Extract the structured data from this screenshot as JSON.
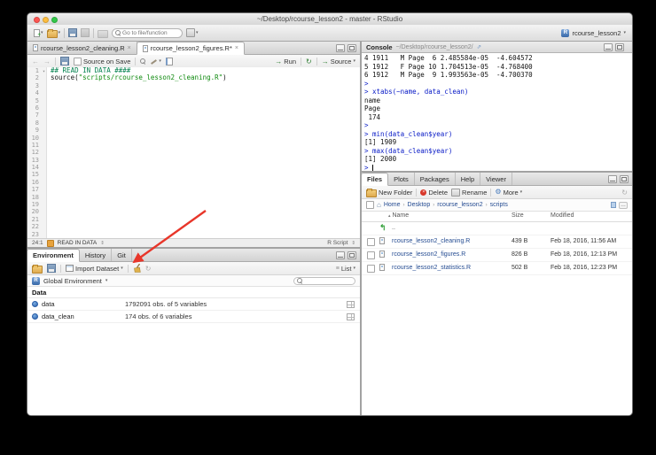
{
  "colors": {
    "console_command_blue": "#0618c6",
    "comment_green": "#00804d",
    "string_green": "#0f8a0f",
    "file_link_blue": "#254c92",
    "annotation_arrow_red": "#e8362a",
    "traffic_red": "#fc5652",
    "traffic_yellow": "#fdbe40",
    "traffic_green": "#34c84a"
  },
  "window": {
    "title": "~/Desktop/rcourse_lesson2 - master - RStudio"
  },
  "main_toolbar": {
    "goto_placeholder": "Go to file/function",
    "project_name": "rcourse_lesson2"
  },
  "source_pane": {
    "tabs": [
      {
        "label": "rcourse_lesson2_cleaning.R"
      },
      {
        "label": "rcourse_lesson2_figures.R*"
      }
    ],
    "toolbar": {
      "source_on_save_label": "Source on Save",
      "run_label": "Run",
      "source_label": "Source"
    },
    "visible_lines": 23,
    "code_lines": [
      {
        "num": "1",
        "fold": true,
        "segments": [
          {
            "text": "## READ IN DATA ####",
            "style": "comment"
          }
        ]
      },
      {
        "num": "2",
        "fold": false,
        "segments": [
          {
            "text": "source(",
            "style": "plain"
          },
          {
            "text": "\"scripts/rcourse_lesson2_cleaning.R\"",
            "style": "string"
          },
          {
            "text": ")",
            "style": "plain"
          }
        ]
      }
    ],
    "status": {
      "cursor_position": "24:1",
      "section_label": "READ IN DATA",
      "file_type": "R Script"
    }
  },
  "console_pane": {
    "title": "Console",
    "path": "~/Desktop/rcourse_lesson2/",
    "lines": [
      {
        "kind": "out",
        "text": "4 1911   M Page  6 2.485584e-05  -4.604572"
      },
      {
        "kind": "out",
        "text": "5 1912   F Page 10 1.704513e-05  -4.768400"
      },
      {
        "kind": "out",
        "text": "6 1912   M Page  9 1.993563e-05  -4.700370"
      },
      {
        "kind": "in",
        "text": ">"
      },
      {
        "kind": "in",
        "text": "> xtabs(~name, data_clean)"
      },
      {
        "kind": "out",
        "text": "name"
      },
      {
        "kind": "out",
        "text": "Page"
      },
      {
        "kind": "out",
        "text": " 174"
      },
      {
        "kind": "in",
        "text": ">"
      },
      {
        "kind": "in",
        "text": "> min(data_clean$year)"
      },
      {
        "kind": "out",
        "text": "[1] 1909"
      },
      {
        "kind": "in",
        "text": "> max(data_clean$year)"
      },
      {
        "kind": "out",
        "text": "[1] 2000"
      },
      {
        "kind": "in",
        "text": "> ",
        "cursor": true
      }
    ]
  },
  "environment_pane": {
    "tabs": [
      {
        "label": "Environment"
      },
      {
        "label": "History"
      },
      {
        "label": "Git"
      }
    ],
    "toolbar": {
      "import_label": "Import Dataset",
      "list_label": "List"
    },
    "scope": "Global Environment",
    "section_header": "Data",
    "objects": [
      {
        "name": "data",
        "description": "1792091 obs. of 5 variables"
      },
      {
        "name": "data_clean",
        "description": "174 obs. of 6 variables"
      }
    ]
  },
  "files_pane": {
    "tabs": [
      {
        "label": "Files"
      },
      {
        "label": "Plots"
      },
      {
        "label": "Packages"
      },
      {
        "label": "Help"
      },
      {
        "label": "Viewer"
      }
    ],
    "toolbar": {
      "new_folder": "New Folder",
      "delete": "Delete",
      "rename": "Rename",
      "more": "More"
    },
    "breadcrumb": [
      {
        "label": "Home"
      },
      {
        "label": "Desktop"
      },
      {
        "label": "rcourse_lesson2"
      },
      {
        "label": "scripts"
      }
    ],
    "columns": {
      "name": "Name",
      "size": "Size",
      "modified": "Modified"
    },
    "parent_row": "..",
    "files": [
      {
        "name": "rcourse_lesson2_cleaning.R",
        "size": "439 B",
        "modified": "Feb 18, 2016, 11:56 AM"
      },
      {
        "name": "rcourse_lesson2_figures.R",
        "size": "826 B",
        "modified": "Feb 18, 2016, 12:13 PM"
      },
      {
        "name": "rcourse_lesson2_statistics.R",
        "size": "502 B",
        "modified": "Feb 18, 2016, 12:23 PM"
      }
    ]
  },
  "icons": {
    "dropdown": "▾",
    "close": "×",
    "chevron": "›",
    "home": "⌂",
    "parent_up": "↰",
    "refresh": "↻",
    "external": "⇗",
    "updown": "⇕",
    "list": "≡",
    "gear": "⚙",
    "back": "←",
    "forward": "→",
    "run": "→",
    "ellipsis": "…",
    "sort_asc": "▴"
  },
  "annotation": {
    "arrow_color": "#e8362a",
    "target": "clear-environment-broom-button"
  }
}
